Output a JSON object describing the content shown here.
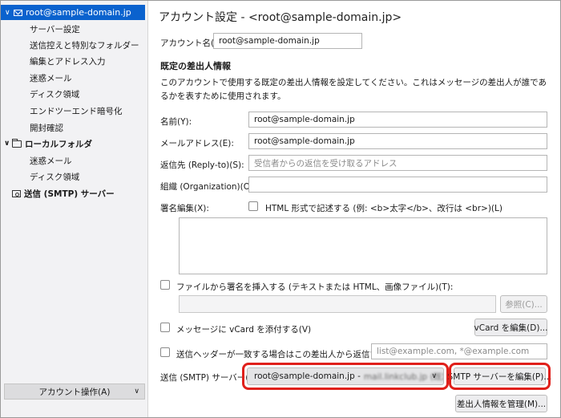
{
  "sidebar": {
    "account_label": "root@sample-domain.jp",
    "account_items": [
      "サーバー設定",
      "送信控えと特別なフォルダー",
      "編集とアドレス入力",
      "迷惑メール",
      "ディスク領域",
      "エンドツーエンド暗号化",
      "開封確認"
    ],
    "local_folders_label": "ローカルフォルダ",
    "local_items": [
      "迷惑メール",
      "ディスク領域"
    ],
    "smtp_label": "送信 (SMTP) サーバー",
    "account_actions": "アカウント操作(A)"
  },
  "main": {
    "title": "アカウント設定 - <root@sample-domain.jp>",
    "account_name_label": "アカウント名(N):",
    "account_name_value": "root@sample-domain.jp",
    "identity_heading": "既定の差出人情報",
    "identity_desc": "このアカウントで使用する既定の差出人情報を設定してください。これはメッセージの差出人が誰であるかを表すために使用されます。",
    "name_label": "名前(Y):",
    "name_value": "root@sample-domain.jp",
    "email_label": "メールアドレス(E):",
    "email_value": "root@sample-domain.jp",
    "replyto_label": "返信先 (Reply-to)(S):",
    "replyto_placeholder": "受信者からの返信を受け取るアドレス",
    "org_label": "組織 (Organization)(O):",
    "org_value": "",
    "sig_label": "署名編集(X):",
    "html_sig_label": "HTML 形式で記述する (例: <b>太字</b>、改行は <br>)(L)",
    "sig_file_label": "ファイルから署名を挿入する (テキストまたは HTML、画像ファイル)(T):",
    "browse_button": "参照(C)...",
    "vcard_label": "メッセージに vCard を添付する(V)",
    "vcard_button": "vCard を編集(D)...",
    "reply_identity_label": "送信ヘッダーが一致する場合はこの差出人から返信する(I):",
    "reply_identity_placeholder": "list@example.com, *@example.com",
    "smtp_label": "送信 (SMTP) サーバー(U):",
    "smtp_value": "root@sample-domain.jp - ",
    "smtp_value_blurred": "mail.linkclub.jp (既定)",
    "smtp_edit_button": "SMTP サーバーを編集(P)...",
    "manage_identities_button": "差出人情報を管理(M)..."
  },
  "colors": {
    "accent": "#0a62ce",
    "highlight": "#e0201b"
  },
  "icons": {
    "account": "envelope-icon",
    "folder": "folder-icon",
    "smtp": "smtp-server-icon"
  }
}
